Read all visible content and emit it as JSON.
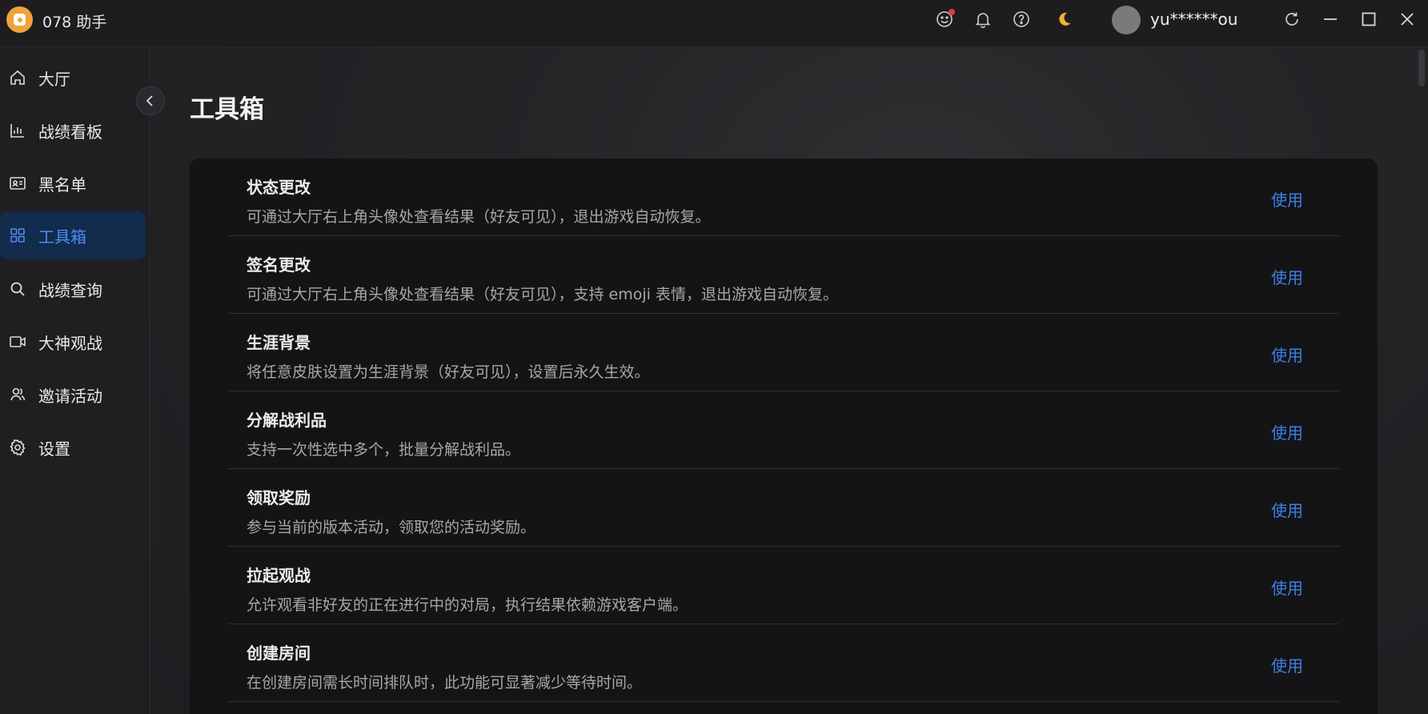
{
  "app": {
    "title": "078 助手",
    "username": "yu******ou"
  },
  "colors": {
    "accent": "#3e7fe6",
    "logo": "#f0a23b",
    "notification": "#e53935"
  },
  "titlebar_icons": [
    "smiley-icon",
    "bell-icon",
    "help-icon",
    "moon-icon",
    "refresh-icon",
    "minimize-icon",
    "maximize-icon",
    "close-icon"
  ],
  "sidebar": {
    "items": [
      {
        "label": "大厅",
        "icon": "home-icon"
      },
      {
        "label": "战绩看板",
        "icon": "bar-chart-icon"
      },
      {
        "label": "黑名单",
        "icon": "id-card-icon"
      },
      {
        "label": "工具箱",
        "icon": "grid-icon",
        "active": true
      },
      {
        "label": "战绩查询",
        "icon": "search-icon"
      },
      {
        "label": "大神观战",
        "icon": "video-icon"
      },
      {
        "label": "邀请活动",
        "icon": "users-icon"
      },
      {
        "label": "设置",
        "icon": "gear-icon"
      }
    ]
  },
  "main": {
    "title": "工具箱",
    "tools": [
      {
        "name": "状态更改",
        "desc": "可通过大厅右上角头像处查看结果（好友可见），退出游戏自动恢复。",
        "action": "使用"
      },
      {
        "name": "签名更改",
        "desc": "可通过大厅右上角头像处查看结果（好友可见），支持 emoji 表情，退出游戏自动恢复。",
        "action": "使用"
      },
      {
        "name": "生涯背景",
        "desc": "将任意皮肤设置为生涯背景（好友可见），设置后永久生效。",
        "action": "使用"
      },
      {
        "name": "分解战利品",
        "desc": "支持一次性选中多个，批量分解战利品。",
        "action": "使用"
      },
      {
        "name": "领取奖励",
        "desc": "参与当前的版本活动，领取您的活动奖励。",
        "action": "使用"
      },
      {
        "name": "拉起观战",
        "desc": "允许观看非好友的正在进行中的对局，执行结果依赖游戏客户端。",
        "action": "使用"
      },
      {
        "name": "创建房间",
        "desc": "在创建房间需长时间排队时，此功能可显著减少等待时间。",
        "action": "使用"
      }
    ]
  }
}
